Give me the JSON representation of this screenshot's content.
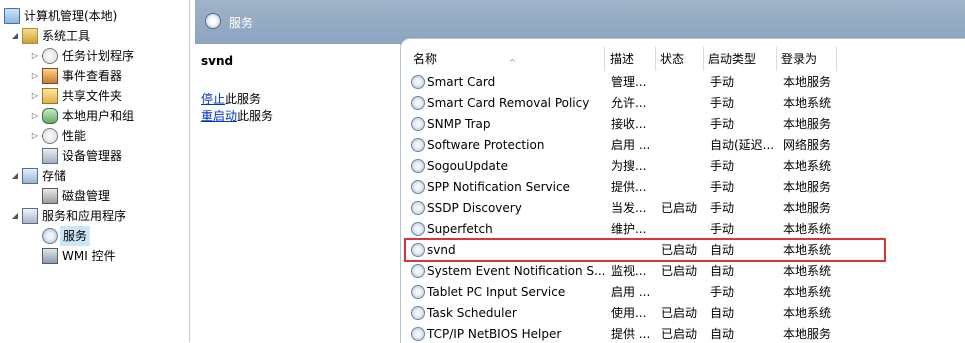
{
  "tree": {
    "items": [
      {
        "label": "计算机管理(本地)",
        "icon": "computer-icon",
        "expander": ""
      },
      {
        "label": "系统工具",
        "icon": "tools-icon",
        "expander": "◢"
      },
      {
        "label": "任务计划程序",
        "icon": "clock-icon",
        "expander": "▷"
      },
      {
        "label": "事件查看器",
        "icon": "event-viewer-icon",
        "expander": "▷"
      },
      {
        "label": "共享文件夹",
        "icon": "shared-folder-icon",
        "expander": "▷"
      },
      {
        "label": "本地用户和组",
        "icon": "users-icon",
        "expander": "▷"
      },
      {
        "label": "性能",
        "icon": "performance-icon",
        "expander": "▷"
      },
      {
        "label": "设备管理器",
        "icon": "device-manager-icon",
        "expander": ""
      },
      {
        "label": "存储",
        "icon": "storage-icon",
        "expander": "◢"
      },
      {
        "label": "磁盘管理",
        "icon": "disk-icon",
        "expander": ""
      },
      {
        "label": "服务和应用程序",
        "icon": "apps-icon",
        "expander": "◢"
      },
      {
        "label": "服务",
        "icon": "services-gear-icon",
        "expander": "",
        "selected": true
      },
      {
        "label": "WMI 控件",
        "icon": "wmi-icon",
        "expander": ""
      }
    ]
  },
  "header": {
    "title": "服务"
  },
  "detail": {
    "service_name": "svnd",
    "stop_link": "停止",
    "stop_suffix": "此服务",
    "restart_link": "重启动",
    "restart_suffix": "此服务"
  },
  "table": {
    "columns": {
      "name": "名称",
      "desc": "描述",
      "status": "状态",
      "start": "启动类型",
      "logon": "登录为"
    },
    "rows": [
      {
        "name": "Smart Card",
        "desc": "管理...",
        "status": "",
        "start": "手动",
        "logon": "本地服务"
      },
      {
        "name": "Smart Card Removal Policy",
        "desc": "允许...",
        "status": "",
        "start": "手动",
        "logon": "本地系统"
      },
      {
        "name": "SNMP Trap",
        "desc": "接收...",
        "status": "",
        "start": "手动",
        "logon": "本地服务"
      },
      {
        "name": "Software Protection",
        "desc": "启用 ...",
        "status": "",
        "start": "自动(延迟...",
        "logon": "网络服务"
      },
      {
        "name": "SogouUpdate",
        "desc": "为搜...",
        "status": "",
        "start": "手动",
        "logon": "本地系统"
      },
      {
        "name": "SPP Notification Service",
        "desc": "提供...",
        "status": "",
        "start": "手动",
        "logon": "本地服务"
      },
      {
        "name": "SSDP Discovery",
        "desc": "当发...",
        "status": "已启动",
        "start": "手动",
        "logon": "本地服务"
      },
      {
        "name": "Superfetch",
        "desc": "维护...",
        "status": "",
        "start": "手动",
        "logon": "本地系统"
      },
      {
        "name": "svnd",
        "desc": "",
        "status": "已启动",
        "start": "自动",
        "logon": "本地系统"
      },
      {
        "name": "System Event Notification S...",
        "desc": "监视...",
        "status": "已启动",
        "start": "自动",
        "logon": "本地系统"
      },
      {
        "name": "Tablet PC Input Service",
        "desc": "启用 ...",
        "status": "",
        "start": "手动",
        "logon": "本地系统"
      },
      {
        "name": "Task Scheduler",
        "desc": "使用...",
        "status": "已启动",
        "start": "自动",
        "logon": "本地系统"
      },
      {
        "name": "TCP/IP NetBIOS Helper",
        "desc": "提供 ...",
        "status": "已启动",
        "start": "自动",
        "logon": "本地服务"
      }
    ]
  },
  "colors": {
    "highlight": "#d9363b",
    "header_bg": "#9fb3c9",
    "link": "#0033cc",
    "selection": "#cde6f7"
  }
}
